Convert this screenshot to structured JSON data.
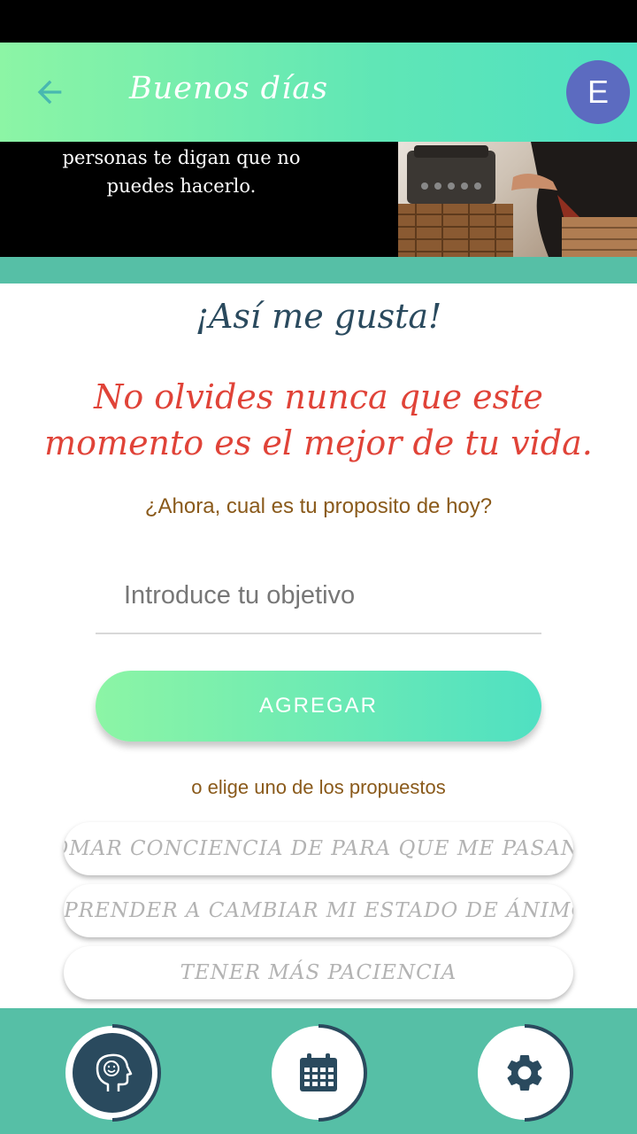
{
  "app_bar": {
    "title": "Buenos días",
    "avatar_initial": "E",
    "back_icon": "arrow-left-icon"
  },
  "banner": {
    "quote": "personas te digan que no puedes hacerlo."
  },
  "main": {
    "praise": "¡Así me gusta!",
    "affirmation": "No olvides nunca que este momento es el mejor de tu vida.",
    "question": "¿Ahora, cual es tu proposito de hoy?",
    "goal_placeholder": "Introduce tu objetivo",
    "goal_value": "",
    "add_button": "AGREGAR",
    "or_choose": "o elige uno de los propuestos"
  },
  "suggestions": [
    "TOMAR CONCIENCIA DE PARA QUE ME PASAN LAS COSAS",
    "APRENDER A CAMBIAR MI ESTADO DE ÁNIMO",
    "TENER MÁS PACIENCIA"
  ],
  "bottom_nav": {
    "items": [
      {
        "icon": "mind-head-icon",
        "active": true
      },
      {
        "icon": "calendar-icon",
        "active": false
      },
      {
        "icon": "gear-icon",
        "active": false
      }
    ]
  },
  "colors": {
    "gradient_start": "#8cf5a5",
    "gradient_end": "#4fe0c2",
    "teal": "#56bfa6",
    "navy": "#2a4a5e",
    "affirmation_red": "#e04338",
    "question_brown": "#8a5a1b",
    "avatar": "#5c6bc0"
  }
}
